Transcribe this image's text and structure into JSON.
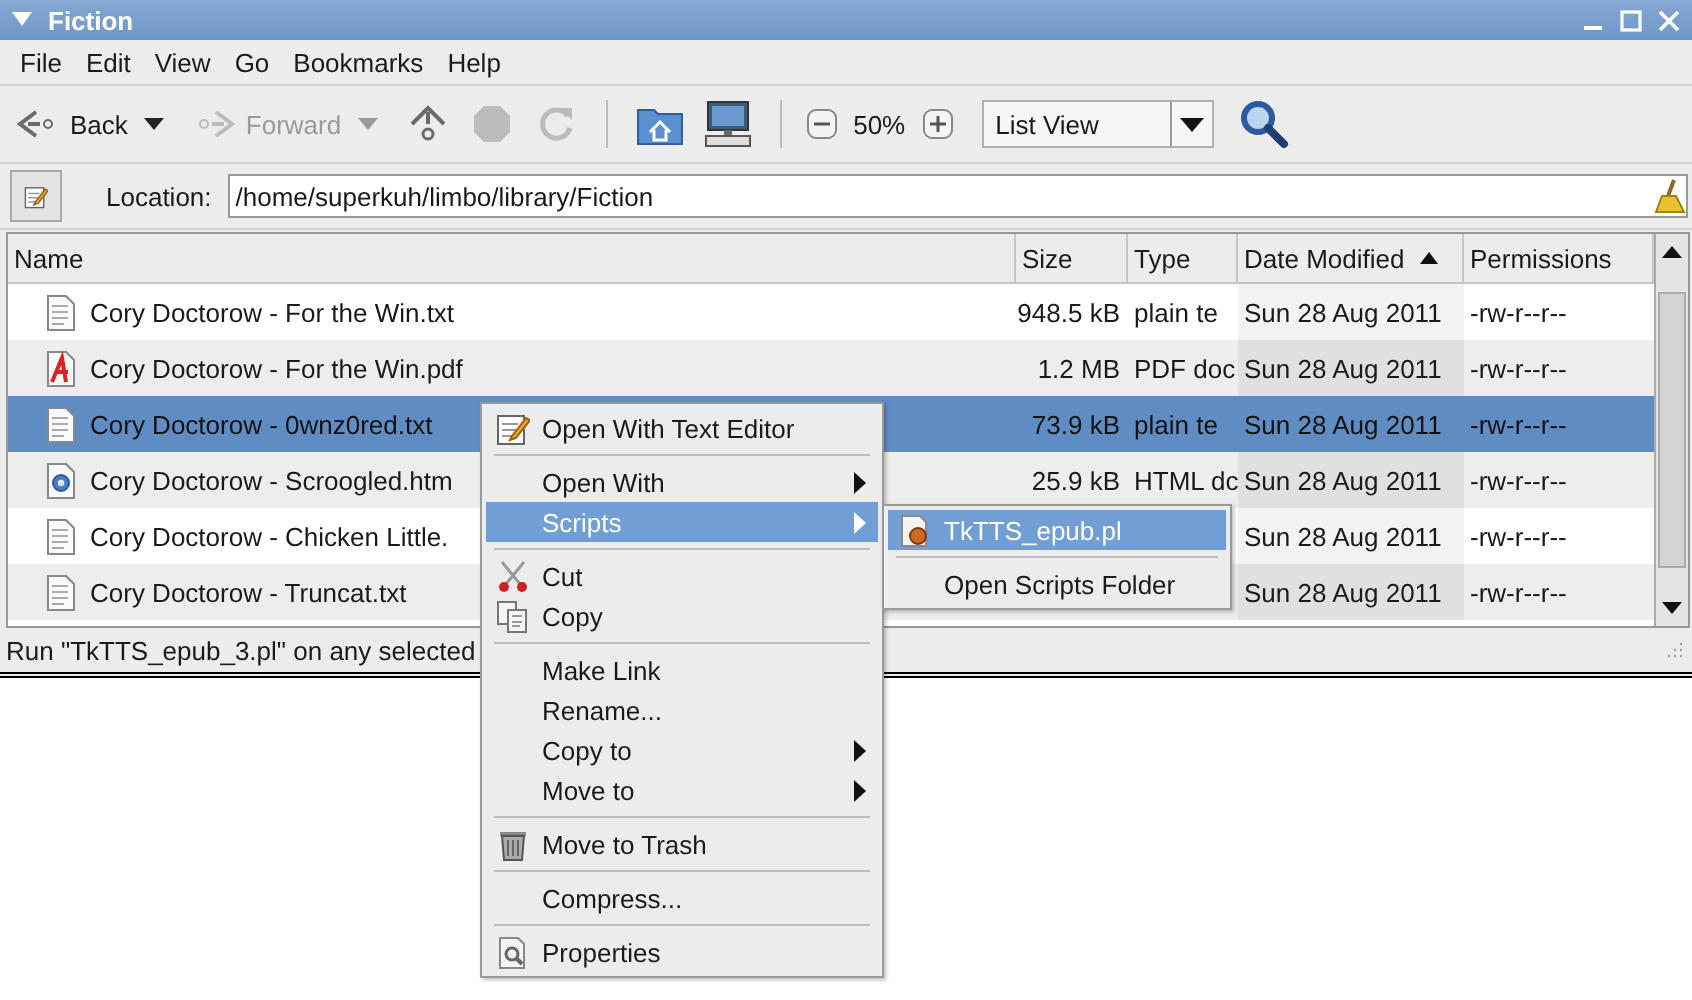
{
  "window": {
    "title": "Fiction"
  },
  "menubar": [
    "File",
    "Edit",
    "View",
    "Go",
    "Bookmarks",
    "Help"
  ],
  "toolbar": [
    {
      "kind": "back",
      "label": "Back",
      "disabled": false
    },
    {
      "kind": "forward",
      "label": "Forward",
      "disabled": true
    },
    {
      "kind": "up",
      "disabled": false
    },
    {
      "kind": "stop",
      "disabled": true
    },
    {
      "kind": "reload",
      "disabled": true
    },
    {
      "kind": "home"
    },
    {
      "kind": "computer"
    }
  ],
  "zoom": {
    "value": "50%"
  },
  "view_select": {
    "value": "List View"
  },
  "location": {
    "label": "Location:",
    "value": "/home/superkuh/limbo/library/Fiction"
  },
  "columns": [
    {
      "label": "Name",
      "sorted": false
    },
    {
      "label": "Size",
      "sorted": false
    },
    {
      "label": "Type",
      "sorted": false
    },
    {
      "label": "Date Modified",
      "sorted": true
    },
    {
      "label": "Permissions",
      "sorted": false
    }
  ],
  "rows": [
    {
      "kind": "text",
      "name": "Cory Doctorow - For the Win.txt",
      "size": "948.5 kB",
      "type": "plain te",
      "date": "Sun 28 Aug 2011",
      "permissions": "-rw-r--r--",
      "selected": false
    },
    {
      "kind": "pdf",
      "name": "Cory Doctorow - For the Win.pdf",
      "size": "1.2 MB",
      "type": "PDF doc",
      "date": "Sun 28 Aug 2011",
      "permissions": "-rw-r--r--",
      "selected": false
    },
    {
      "kind": "text",
      "name": "Cory Doctorow - 0wnz0red.txt",
      "size": "73.9 kB",
      "type": "plain te",
      "date": "Sun 28 Aug 2011",
      "permissions": "-rw-r--r--",
      "selected": true
    },
    {
      "kind": "html",
      "name": "Cory Doctorow - Scroogled.htm",
      "size": "25.9 kB",
      "type": "HTML dc",
      "date": "Sun 28 Aug 2011",
      "permissions": "-rw-r--r--",
      "selected": false
    },
    {
      "kind": "text",
      "name": "Cory Doctorow - Chicken Little.",
      "date": "Sun 28 Aug 2011",
      "permissions": "-rw-r--r--",
      "selected": false
    },
    {
      "kind": "text",
      "name": "Cory Doctorow - Truncat.txt",
      "date": "Sun 28 Aug 2011",
      "permissions": "-rw-r--r--",
      "selected": false
    }
  ],
  "status_bar": "Run \"TkTTS_epub_3.pl\" on any selected",
  "context_menu": [
    {
      "kind": "item",
      "label": "Open With Text Editor",
      "submenu": false,
      "selected": false
    },
    {
      "kind": "separator"
    },
    {
      "kind": "item",
      "label": "Open With",
      "submenu": true,
      "selected": false
    },
    {
      "kind": "item",
      "label": "Scripts",
      "submenu": true,
      "selected": true
    },
    {
      "kind": "separator"
    },
    {
      "kind": "item",
      "label": "Cut",
      "submenu": false,
      "selected": false
    },
    {
      "kind": "item",
      "label": "Copy",
      "submenu": false,
      "selected": false
    },
    {
      "kind": "separator"
    },
    {
      "kind": "item",
      "label": "Make Link",
      "submenu": false,
      "selected": false
    },
    {
      "kind": "item",
      "label": "Rename...",
      "submenu": false,
      "selected": false
    },
    {
      "kind": "item",
      "label": "Copy to",
      "submenu": true,
      "selected": false
    },
    {
      "kind": "item",
      "label": "Move to",
      "submenu": true,
      "selected": false
    },
    {
      "kind": "separator"
    },
    {
      "kind": "item",
      "label": "Move to Trash",
      "submenu": false,
      "selected": false
    },
    {
      "kind": "separator"
    },
    {
      "kind": "item",
      "label": "Compress...",
      "submenu": false,
      "selected": false
    },
    {
      "kind": "separator"
    },
    {
      "kind": "item",
      "label": "Properties",
      "submenu": false,
      "selected": false
    }
  ],
  "scripts_menu": [
    {
      "kind": "item",
      "label": "TkTTS_epub.pl",
      "selected": true
    },
    {
      "kind": "separator"
    },
    {
      "kind": "item",
      "label": "Open Scripts Folder",
      "selected": false
    }
  ]
}
